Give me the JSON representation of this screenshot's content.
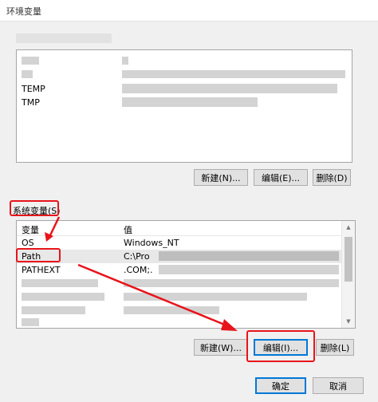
{
  "window": {
    "title": "环境变量"
  },
  "user_vars": {
    "rows": [
      {
        "name": "TEMP"
      },
      {
        "name": "TMP"
      }
    ],
    "buttons": {
      "new": "新建(N)...",
      "edit": "编辑(E)...",
      "delete": "删除(D)"
    }
  },
  "system_vars": {
    "group_label": "系统变量(S)",
    "headers": {
      "name": "变量",
      "value": "值"
    },
    "rows": [
      {
        "name": "OS",
        "value": "Windows_NT"
      },
      {
        "name": "Path",
        "value": "C:\\Pro"
      },
      {
        "name": "PATHEXT",
        "value": ".COM;."
      }
    ],
    "buttons": {
      "new": "新建(W)...",
      "edit": "编辑(I)...",
      "delete": "删除(L)"
    }
  },
  "footer": {
    "ok": "确定",
    "cancel": "取消"
  },
  "colors": {
    "annotation": "#e8141b",
    "focus": "#0078d7"
  }
}
